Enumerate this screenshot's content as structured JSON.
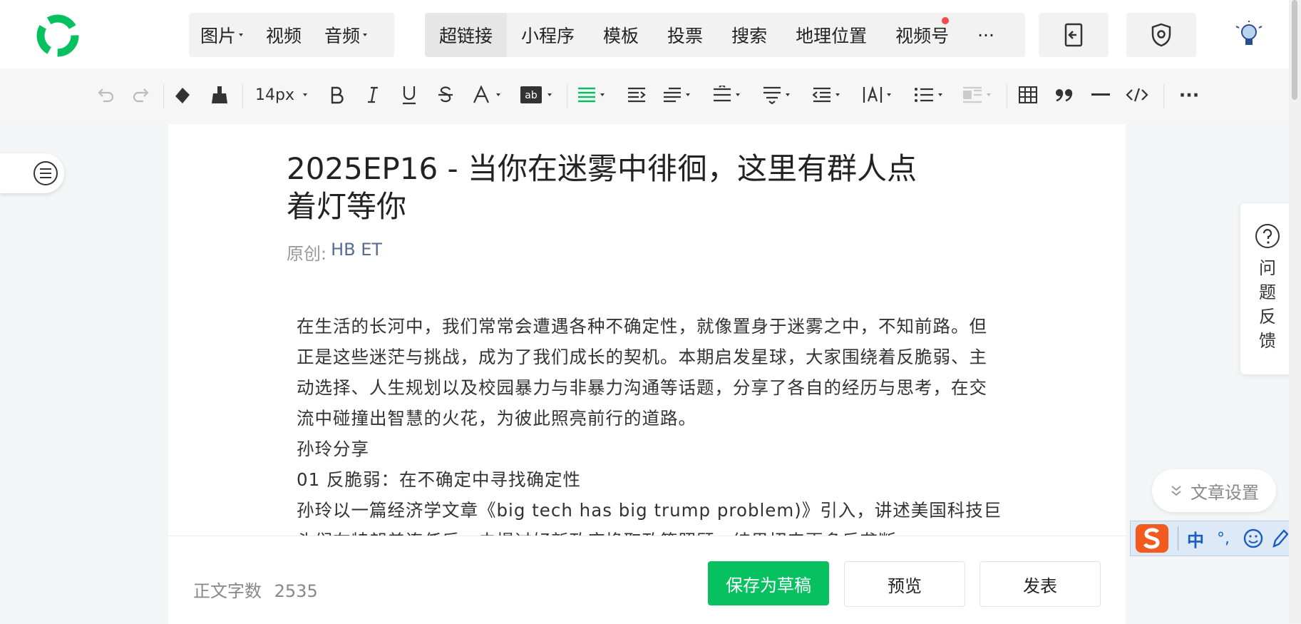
{
  "topbar": {
    "media": [
      {
        "label": "图片",
        "has_caret": true
      },
      {
        "label": "视频",
        "has_caret": false
      },
      {
        "label": "音频",
        "has_caret": true
      }
    ],
    "inserts": [
      {
        "label": "超链接",
        "active": true
      },
      {
        "label": "小程序"
      },
      {
        "label": "模板"
      },
      {
        "label": "投票"
      },
      {
        "label": "搜索"
      },
      {
        "label": "地理位置"
      },
      {
        "label": "视频号",
        "badge": true
      },
      {
        "label": "···"
      }
    ],
    "icons": [
      "export-icon",
      "shield-icon",
      "bulb-avatar-icon"
    ]
  },
  "toolbar": {
    "font_size": "14px",
    "icons": [
      "undo-icon",
      "redo-icon",
      "eraser-icon",
      "format-brush-icon",
      "bold-icon",
      "italic-icon",
      "underline-icon",
      "strikethrough-icon",
      "font-color-icon",
      "background-color-icon",
      "align-icon",
      "indent-icon",
      "first-line-indent-icon",
      "line-height-icon",
      "paragraph-spacing-icon",
      "outdent-icon",
      "letter-spacing-icon",
      "list-icon",
      "float-icon",
      "table-icon",
      "quote-icon",
      "divider-icon",
      "code-icon",
      "more-icon"
    ],
    "more": "···"
  },
  "article": {
    "title": "2025EP16 - 当你在迷雾中徘徊，这里有群人点着灯等你",
    "original_label": "原创:",
    "author": "HB ET",
    "paragraphs": [
      "在生活的长河中，我们常常会遭遇各种不确定性，就像置身于迷雾之中，不知前路。但正是这些迷茫与挑战，成为了我们成长的契机。本期启发星球，大家围绕着反脆弱、主动选择、人生规划以及校园暴力与非暴力沟通等话题，分享了各自的经历与思考，在交流中碰撞出智慧的火花，为彼此照亮前行的道路。",
      "孙玲分享",
      "01 反脆弱：在不确定中寻找确定性",
      "孙玲以一篇经济学文章《big tech has big trump problem)》引入，讲述美国科技巨头们在特朗普连任后，未提过好新政府换取政策照顾，结果招来更多反垄断"
    ]
  },
  "footer": {
    "word_count_label": "正文字数",
    "word_count": "2535",
    "save_draft": "保存为草稿",
    "preview": "预览",
    "publish": "发表"
  },
  "sidebar": {
    "feedback_label": "问题反馈",
    "settings_label": "文章设置"
  },
  "ime": {
    "mode": "中",
    "punct": "°,"
  },
  "colors": {
    "brand_green": "#07c160",
    "link_blue": "#576b95",
    "badge_red": "#f5484b"
  }
}
